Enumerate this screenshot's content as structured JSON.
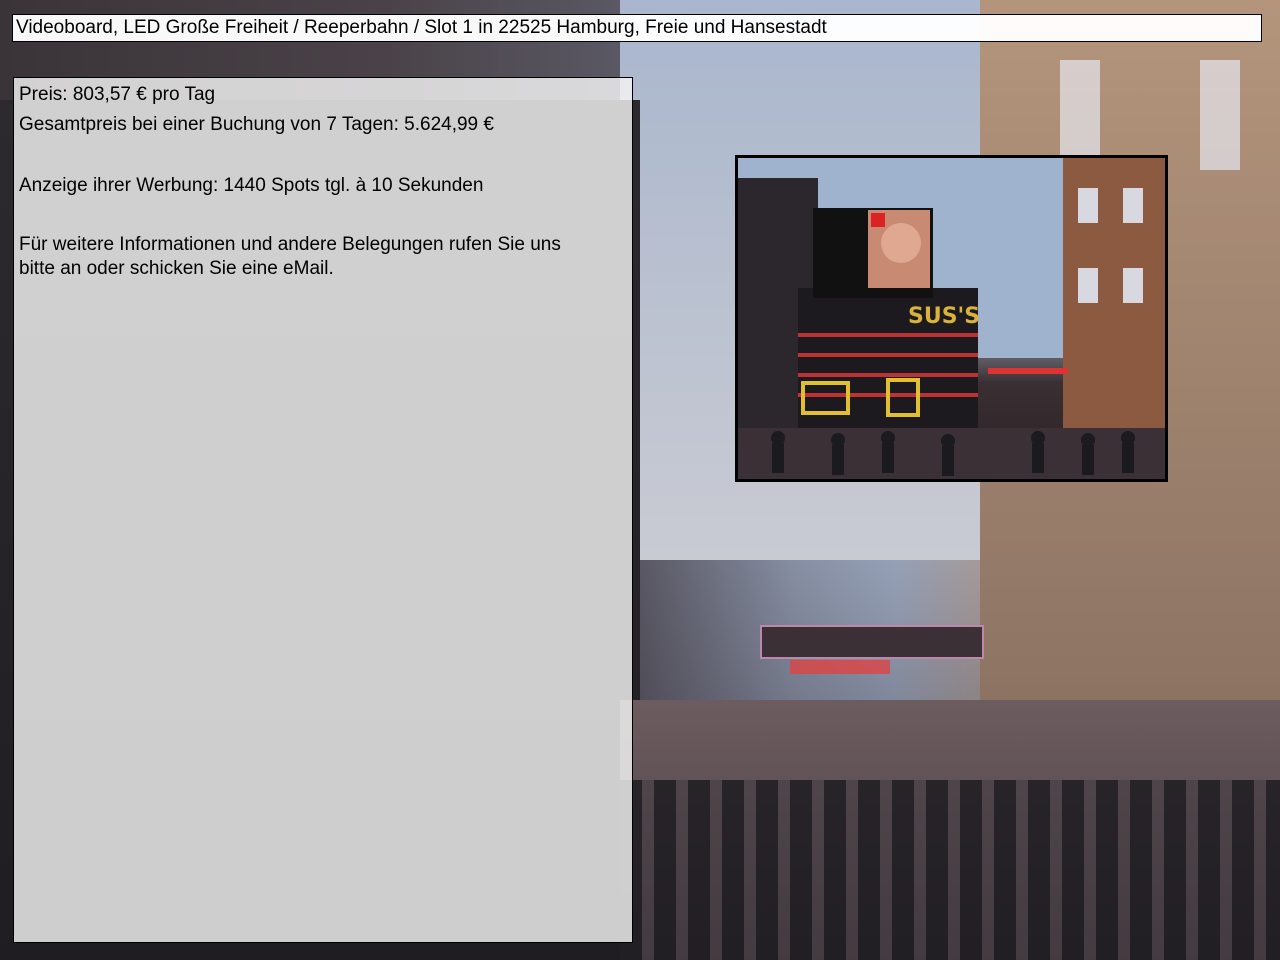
{
  "title": "Videoboard, LED Große Freiheit / Reeperbahn / Slot 1 in 22525 Hamburg, Freie und Hansestadt",
  "info": {
    "price": "Preis: 803,57 € pro Tag",
    "total": "Gesamtpreis bei einer Buchung von 7 Tagen: 5.624,99 €",
    "display": "Anzeige ihrer Werbung: 1440 Spots tgl. à 10 Sekunden",
    "more": "Für weitere Informationen und andere Belegungen rufen Sie uns bitte an oder schicken Sie eine eMail."
  },
  "images": {
    "thumbnail": "street-photo-videoboard",
    "background": "street-photo-background"
  },
  "colors": {
    "panel_bg": "#f5f5f5",
    "border": "#000000"
  }
}
